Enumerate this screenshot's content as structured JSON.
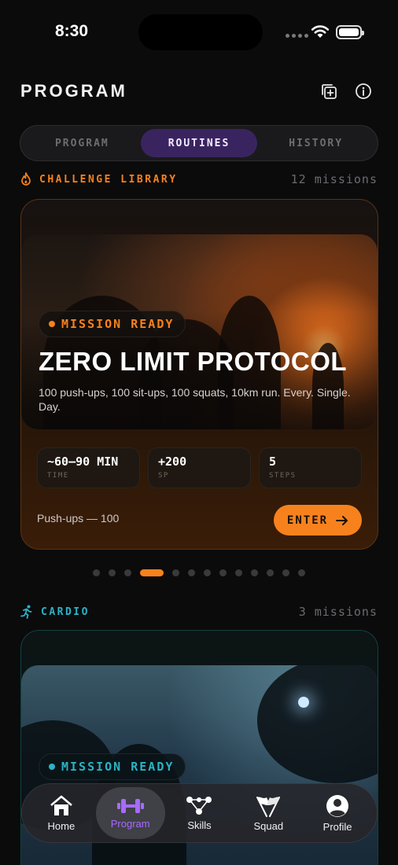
{
  "status_bar": {
    "time": "8:30"
  },
  "header": {
    "title": "PROGRAM"
  },
  "segments": [
    {
      "label": "PROGRAM",
      "active": false
    },
    {
      "label": "ROUTINES",
      "active": true
    },
    {
      "label": "HISTORY",
      "active": false
    }
  ],
  "challenge_section": {
    "label": "CHALLENGE LIBRARY",
    "count": "12 missions",
    "color": "#f7821d"
  },
  "featured_card": {
    "badge": "MISSION READY",
    "title": "ZERO LIMIT PROTOCOL",
    "description": "100 push-ups, 100 sit-ups, 100 squats, 10km run. Every. Single. Day.",
    "stats": [
      {
        "value": "~60–90 MIN",
        "key": "TIME"
      },
      {
        "value": "+200",
        "key": "SP"
      },
      {
        "value": "5",
        "key": "STEPS"
      }
    ],
    "footer_text": "Push-ups — 100",
    "enter_label": "ENTER",
    "accent": "#f7821d"
  },
  "pager": {
    "total": 13,
    "active_index": 3
  },
  "cardio_section": {
    "label": "CARDIO",
    "count": "3 missions",
    "color": "#2bb3c6"
  },
  "cardio_card": {
    "badge": "MISSION READY",
    "accent": "#2bb3c6"
  },
  "tabbar": [
    {
      "label": "Home",
      "icon": "home-icon",
      "active": false
    },
    {
      "label": "Program",
      "icon": "dumbbell-icon",
      "active": true
    },
    {
      "label": "Skills",
      "icon": "skills-tree-icon",
      "active": false
    },
    {
      "label": "Squad",
      "icon": "flags-icon",
      "active": false
    },
    {
      "label": "Profile",
      "icon": "profile-icon",
      "active": false
    }
  ]
}
